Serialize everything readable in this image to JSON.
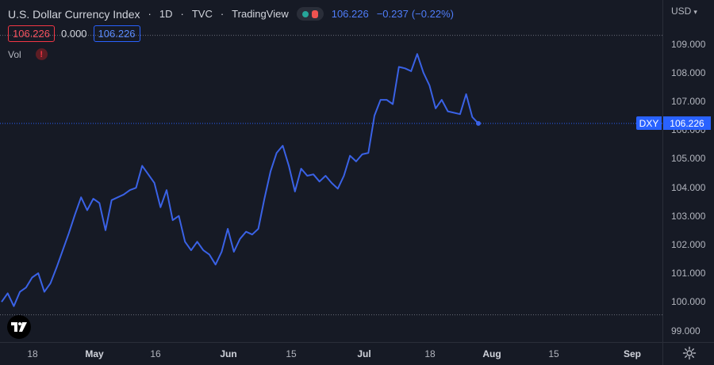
{
  "legend": {
    "title": "U.S. Dollar Currency Index",
    "interval": "1D",
    "exchange": "TVC",
    "provider": "TradingView",
    "last": "106.226",
    "change": "−0.237",
    "change_pct": "(−0.22%)",
    "sep1": "·",
    "sep2": "·",
    "sep3": "·"
  },
  "quote": {
    "bid": "106.226",
    "spread": "0.000",
    "ask": "106.226"
  },
  "volume": {
    "label": "Vol",
    "warning": "!"
  },
  "price_axis": {
    "currency": "USD",
    "chevron": "▾"
  },
  "price_tag": {
    "symbol": "DXY",
    "price": "106.226",
    "color": "#2962ff"
  },
  "icons": {
    "logo": "tradingview-logo-icon",
    "settings": "gear-icon",
    "collapse": "chevron-up-icon"
  },
  "colors": {
    "line": "#3a62e6",
    "background": "#161a25",
    "bid_border": "#f23645",
    "ask_border": "#2962ff"
  },
  "chart_data": {
    "type": "line",
    "title": "U.S. Dollar Currency Index",
    "y_ticks": [
      "99.000",
      "100.000",
      "101.000",
      "102.000",
      "103.000",
      "104.000",
      "105.000",
      "106.000",
      "107.000",
      "108.000",
      "109.000"
    ],
    "x_ticks": [
      "18",
      "May",
      "16",
      "Jun",
      "15",
      "Jul",
      "18",
      "Aug",
      "15",
      "Sep"
    ],
    "x_ticks_bold": [
      "May",
      "Jun",
      "Jul",
      "Aug",
      "Sep"
    ],
    "ylim": [
      98.4,
      110.5
    ],
    "dashed_levels": [
      109.3,
      99.55
    ],
    "series": [
      {
        "values": [
          100.0,
          100.3,
          99.85,
          100.35,
          100.5,
          100.85,
          101.0,
          100.35,
          100.65,
          101.2,
          101.8,
          102.4,
          103.05,
          103.65,
          103.2,
          103.6,
          103.45,
          102.5,
          103.55,
          103.65,
          103.75,
          103.9,
          103.98,
          104.75,
          104.45,
          104.15,
          103.3,
          103.9,
          102.85,
          103.0,
          102.1,
          101.8,
          102.1,
          101.8,
          101.65,
          101.3,
          101.75,
          102.55,
          101.75,
          102.2,
          102.45,
          102.35,
          102.55,
          103.6,
          104.55,
          105.2,
          105.45,
          104.75,
          103.85,
          104.65,
          104.4,
          104.45,
          104.2,
          104.4,
          104.15,
          103.95,
          104.4,
          105.1,
          104.9,
          105.15,
          105.2,
          106.5,
          107.05,
          107.05,
          106.9,
          108.2,
          108.15,
          108.05,
          108.65,
          108.0,
          107.55,
          106.75,
          107.05,
          106.65,
          106.6,
          106.55,
          107.25,
          106.45,
          106.226
        ]
      }
    ]
  }
}
